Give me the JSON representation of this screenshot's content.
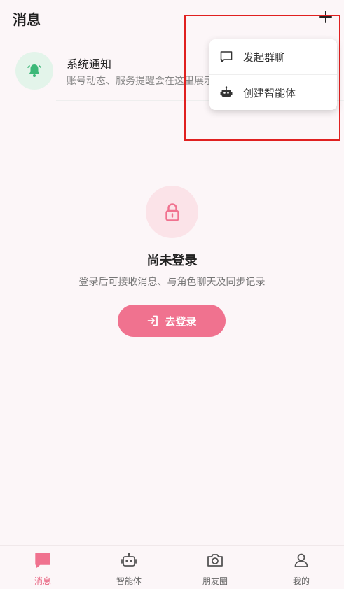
{
  "header": {
    "title": "消息"
  },
  "notice": {
    "title": "系统通知",
    "subtitle": "账号动态、服务提醒会在这里展示"
  },
  "menu": {
    "items": [
      {
        "label": "发起群聊",
        "icon": "chat-bubble-icon"
      },
      {
        "label": "创建智能体",
        "icon": "robot-icon"
      }
    ]
  },
  "empty": {
    "title": "尚未登录",
    "subtitle": "登录后可接收消息、与角色聊天及同步记录",
    "login_label": "去登录"
  },
  "tabs": [
    {
      "label": "消息",
      "icon": "message-icon",
      "active": true
    },
    {
      "label": "智能体",
      "icon": "robot-icon",
      "active": false
    },
    {
      "label": "朋友圈",
      "icon": "camera-icon",
      "active": false
    },
    {
      "label": "我的",
      "icon": "user-icon",
      "active": false
    }
  ],
  "colors": {
    "accent": "#f0728f",
    "bell": "#3cb878",
    "highlight": "#e02020",
    "background": "#fcf6f8"
  }
}
